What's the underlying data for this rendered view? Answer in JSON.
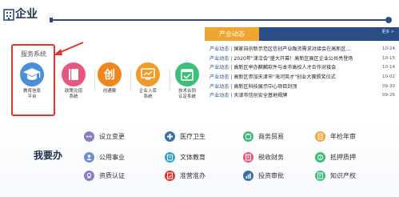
{
  "header": {
    "title": "企业"
  },
  "services": {
    "label": "服务系统",
    "items": [
      {
        "name": "教育信息平台",
        "lines": [
          "教育信息",
          "平台"
        ],
        "icon": "graduation-cap-icon",
        "color": "#4a90d9"
      },
      {
        "name": "政策兑现系统",
        "lines": [
          "政策兑现",
          "系统"
        ],
        "icon": "book-icon",
        "color": "#e8577e"
      },
      {
        "name": "创通票",
        "lines": [
          "创通票"
        ],
        "icon": "chuang-badge-icon",
        "glyph": "创",
        "color": "#f0861e"
      },
      {
        "name": "企业入库系统",
        "lines": [
          "企业入库",
          "系统"
        ],
        "icon": "monitor-chart-icon",
        "color": "#f29a28"
      },
      {
        "name": "技术合同认定系统",
        "lines": [
          "技术合同",
          "认定系统"
        ],
        "icon": "calendar-check-icon",
        "color": "#3dbf7c"
      }
    ]
  },
  "news": {
    "tab_label": "产业动态",
    "more_label": "更多 >",
    "items": [
      {
        "category": "产业动态",
        "sep": "|",
        "title": "国家自创新示范区信创产业融资需求对接会在高新区…",
        "date": "10-24"
      },
      {
        "category": "产业动态",
        "sep": "|",
        "title": "2020年\"津洽会\"盛大开幕！高新区展区企业公共亮登场",
        "date": "10-15"
      },
      {
        "category": "产业动态",
        "sep": "|",
        "title": "高新区举办麒麟软件与本市高校人才合作对接会",
        "date": "10-14"
      },
      {
        "category": "产业动态",
        "sep": "|",
        "title": "高新区参加天津市\"海河英才\"创业大赛颁奖仪式",
        "date": "10-02"
      },
      {
        "category": "产业动态",
        "sep": "|",
        "title": "高新区科技展示中心项目封顶",
        "date": "09-30"
      },
      {
        "category": "产业动态",
        "sep": "|",
        "title": "天津市信创安全基地揭牌",
        "date": "09-26"
      }
    ]
  },
  "todo": {
    "title": "我要办",
    "items": [
      {
        "label": "设立变更",
        "icon": "dots-icon",
        "color": "#8e7cc3"
      },
      {
        "label": "医疗卫生",
        "icon": "medical-icon",
        "color": "#3c6fa8"
      },
      {
        "label": "商务贸易",
        "icon": "trade-icon",
        "color": "#3dbf7c"
      },
      {
        "label": "年检年审",
        "icon": "inspection-icon",
        "color": "#f0a531"
      },
      {
        "label": "公用事业",
        "icon": "public-utility-icon",
        "color": "#6f8fd0"
      },
      {
        "label": "文体教育",
        "icon": "education-icon",
        "color": "#35a3c8"
      },
      {
        "label": "税收财务",
        "icon": "tax-icon",
        "color": "#e8577e"
      },
      {
        "label": "抵押质押",
        "icon": "mortgage-icon",
        "color": "#3dbf7c"
      },
      {
        "label": "资质认证",
        "icon": "certification-icon",
        "color": "#8e7cc3"
      },
      {
        "label": "准营准办",
        "icon": "permit-icon",
        "color": "#e8302c"
      },
      {
        "label": "投资审批",
        "icon": "investment-icon",
        "color": "#3c6fa8"
      },
      {
        "label": "知识产权",
        "icon": "ip-icon",
        "color": "#3dbf7c"
      }
    ]
  }
}
